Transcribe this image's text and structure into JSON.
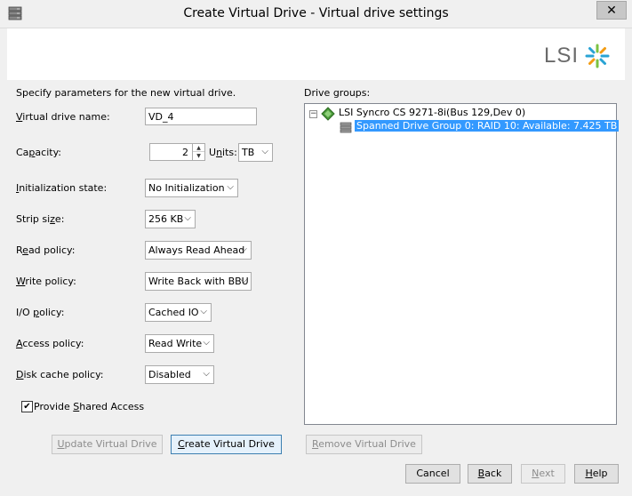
{
  "window": {
    "title": "Create Virtual Drive - Virtual drive settings",
    "close_glyph": "✕"
  },
  "banner": {
    "logo_text": "LSI",
    "logo_mark": "LSI starburst logo"
  },
  "form": {
    "intro": "Specify parameters for the new virtual drive.",
    "name": {
      "label_u": "V",
      "label_rest": "irtual drive name:",
      "value": "VD_4"
    },
    "capacity": {
      "label_pre": "Ca",
      "label_u": "p",
      "label_rest": "acity:",
      "value": "2",
      "units_pre": "U",
      "units_u": "n",
      "units_rest": "its:",
      "units_value": "TB"
    },
    "init_state": {
      "label_u": "I",
      "label_rest": "nitialization state:",
      "value": "No Initialization"
    },
    "strip_size": {
      "label_pre": "Strip si",
      "label_u": "z",
      "label_rest": "e:",
      "value": "256 KB"
    },
    "read_policy": {
      "label_pre": "R",
      "label_u": "e",
      "label_rest": "ad policy:",
      "value": "Always Read Ahead"
    },
    "write_policy": {
      "label_u": "W",
      "label_rest": "rite policy:",
      "value": "Write Back with BBU"
    },
    "io_policy": {
      "label_pre": "I/O ",
      "label_u": "p",
      "label_rest": "olicy:",
      "value": "Cached IO"
    },
    "access_policy": {
      "label_u": "A",
      "label_rest": "ccess policy:",
      "value": "Read Write"
    },
    "disk_cache_policy": {
      "label_u": "D",
      "label_rest": "isk cache policy:",
      "value": "Disabled"
    },
    "shared_access": {
      "label_pre": "Provide ",
      "label_u": "S",
      "label_rest": "hared Access",
      "checked": true
    }
  },
  "drive_groups": {
    "label": "Drive groups:",
    "controller": "LSI Syncro CS 9271-8i(Bus 129,Dev 0)",
    "group": "Spanned Drive Group 0: RAID 10: Available: 7.425 TB"
  },
  "buttons": {
    "update": {
      "pre": "",
      "u": "U",
      "rest": "pdate Virtual Drive"
    },
    "create": {
      "pre": "",
      "u": "C",
      "rest": "reate Virtual Drive"
    },
    "remove": {
      "pre": "",
      "u": "R",
      "rest": "emove Virtual Drive"
    },
    "cancel": "Cancel",
    "back": {
      "u": "B",
      "rest": "ack"
    },
    "next": {
      "u": "N",
      "rest": "ext"
    },
    "help": {
      "u": "H",
      "rest": "elp"
    }
  },
  "colors": {
    "selection": "#3399ff",
    "window_bg": "#f0f0f0"
  }
}
